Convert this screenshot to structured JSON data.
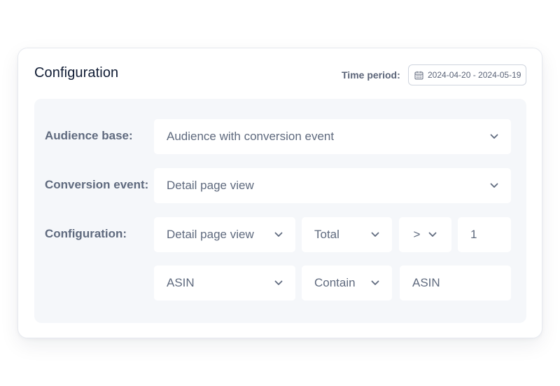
{
  "title": "Configuration",
  "time_period": {
    "label": "Time period:",
    "value": "2024-04-20 - 2024-05-19"
  },
  "audience_base": {
    "label": "Audience base:",
    "value": "Audience with conversion event"
  },
  "conversion_event": {
    "label": "Conversion event:",
    "value": "Detail page view"
  },
  "configuration": {
    "label": "Configuration:",
    "event": "Detail page view",
    "aggregation": "Total",
    "operator": ">",
    "threshold": "1",
    "attribute": "ASIN",
    "match": "Contain",
    "match_value": "ASIN"
  },
  "icons": {
    "calendar": "calendar-icon",
    "chevron": "chevron-down-icon"
  }
}
